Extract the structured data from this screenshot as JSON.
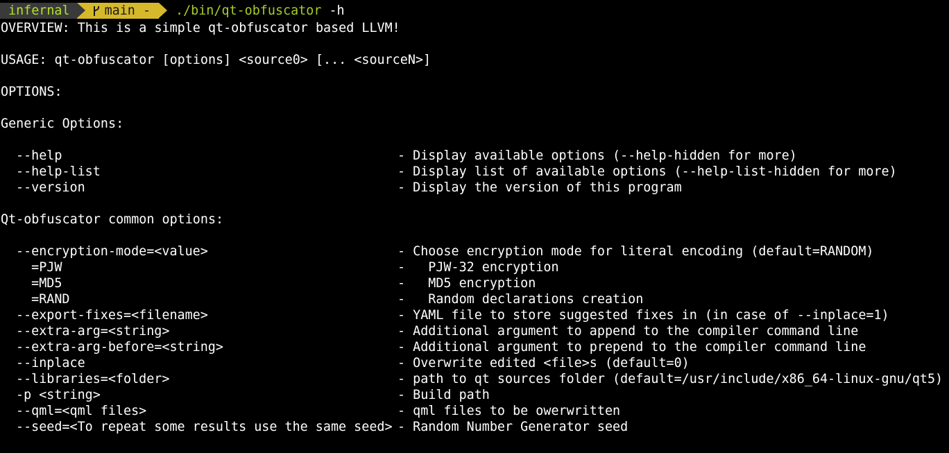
{
  "prompt": {
    "host": "infernal",
    "branch": "main -",
    "command": "./bin/qt-obfuscator",
    "argument": "-h"
  },
  "colors": {
    "host_bg": "#3a3a3a",
    "host_fg": "#b5e02a",
    "git_bg": "#d6b92b",
    "command_fg": "#a7cc2a"
  },
  "icons": {
    "branch": "git-branch-icon"
  },
  "output": {
    "overview": "OVERVIEW: This is a simple qt-obfuscator based LLVM!",
    "usage": "USAGE: qt-obfuscator [options] <source0> [... <sourceN>]",
    "options_header": "OPTIONS:",
    "generic_header": "Generic Options:",
    "generic_options": [
      {
        "flag": "--help",
        "desc": "- Display available options (--help-hidden for more)"
      },
      {
        "flag": "--help-list",
        "desc": "- Display list of available options (--help-list-hidden for more)"
      },
      {
        "flag": "--version",
        "desc": "- Display the version of this program"
      }
    ],
    "common_header": "Qt-obfuscator common options:",
    "common_options": [
      {
        "flag": "--encryption-mode=<value>",
        "desc": "- Choose encryption mode for literal encoding (default=RANDOM)"
      },
      {
        "flag": "  =PJW",
        "desc": "-   PJW-32 encryption"
      },
      {
        "flag": "  =MD5",
        "desc": "-   MD5 encryption"
      },
      {
        "flag": "  =RAND",
        "desc": "-   Random declarations creation"
      },
      {
        "flag": "--export-fixes=<filename>",
        "desc": "- YAML file to store suggested fixes in (in case of --inplace=1)"
      },
      {
        "flag": "--extra-arg=<string>",
        "desc": "- Additional argument to append to the compiler command line"
      },
      {
        "flag": "--extra-arg-before=<string>",
        "desc": "- Additional argument to prepend to the compiler command line"
      },
      {
        "flag": "--inplace",
        "desc": "- Overwrite edited <file>s (default=0)"
      },
      {
        "flag": "--libraries=<folder>",
        "desc": "- path to qt sources folder (default=/usr/include/x86_64-linux-gnu/qt5)"
      },
      {
        "flag": "-p <string>",
        "desc": "- Build path"
      },
      {
        "flag": "--qml=<qml files>",
        "desc": "- qml files to be owerwritten"
      },
      {
        "flag": "--seed=<To repeat some results use the same seed>",
        "desc": "- Random Number Generator seed"
      }
    ]
  }
}
